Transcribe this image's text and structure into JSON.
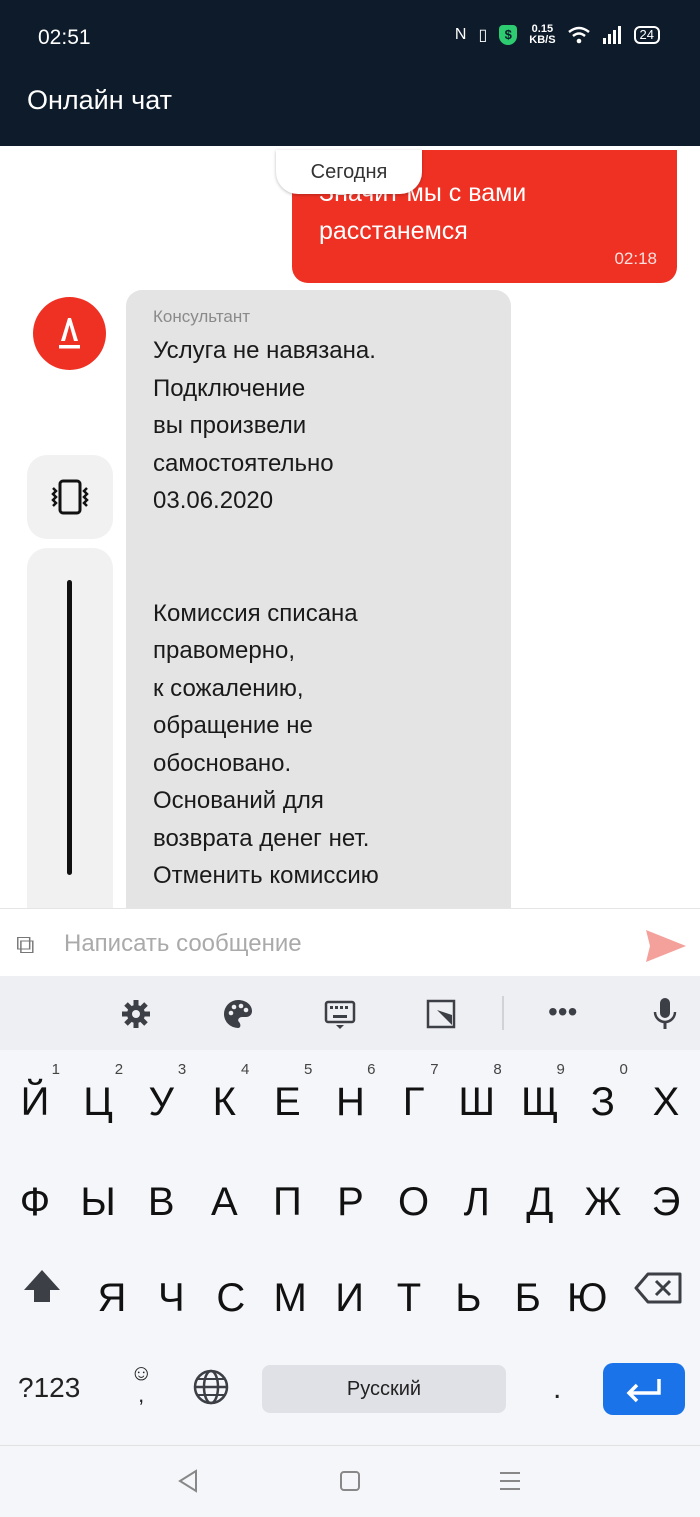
{
  "status_bar": {
    "time": "02:51",
    "net_speed_value": "0.15",
    "net_speed_unit": "KB/S",
    "battery": "24"
  },
  "header": {
    "title": "Онлайн чат"
  },
  "chat": {
    "date_divider": "Сегодня",
    "outgoing": {
      "text": "Значит мы с вами\nрасстанемся",
      "time": "02:18"
    },
    "incoming": {
      "author": "Консультант",
      "text": "Услуга не навязана.\nПодключение\nвы произвели\nсамостоятельно\n03.06.2020\n\n\n Комиссия списана\nправомерно,\nк сожалению,\nобращение не\nобосновано.\nОснований для\nвозврата денег нет.\nОтменить комиссию",
      "avatar_letter": "А"
    }
  },
  "composer": {
    "placeholder": "Написать сообщение",
    "value": ""
  },
  "keyboard": {
    "toolbar_icons": [
      "settings-icon",
      "palette-icon",
      "keyboard-icon",
      "resize-icon",
      "more-icon",
      "mic-icon"
    ],
    "row1": [
      {
        "key": "Й",
        "hint": "1"
      },
      {
        "key": "Ц",
        "hint": "2"
      },
      {
        "key": "У",
        "hint": "3"
      },
      {
        "key": "К",
        "hint": "4"
      },
      {
        "key": "Е",
        "hint": "5"
      },
      {
        "key": "Н",
        "hint": "6"
      },
      {
        "key": "Г",
        "hint": "7"
      },
      {
        "key": "Ш",
        "hint": "8"
      },
      {
        "key": "Щ",
        "hint": "9"
      },
      {
        "key": "З",
        "hint": "0"
      },
      {
        "key": "Х",
        "hint": ""
      }
    ],
    "row2": [
      "Ф",
      "Ы",
      "В",
      "А",
      "П",
      "Р",
      "О",
      "Л",
      "Д",
      "Ж",
      "Э"
    ],
    "row3": [
      "Я",
      "Ч",
      "С",
      "М",
      "И",
      "Т",
      "Ь",
      "Б",
      "Ю"
    ],
    "numbers_key": "?123",
    "comma_key": ",",
    "space_label": "Русский",
    "period_key": ".",
    "colors": {
      "enter": "#1a73e8",
      "send": "#f4a09b",
      "brand_red": "#ef3124",
      "header_bg": "#0e1b2b"
    }
  }
}
